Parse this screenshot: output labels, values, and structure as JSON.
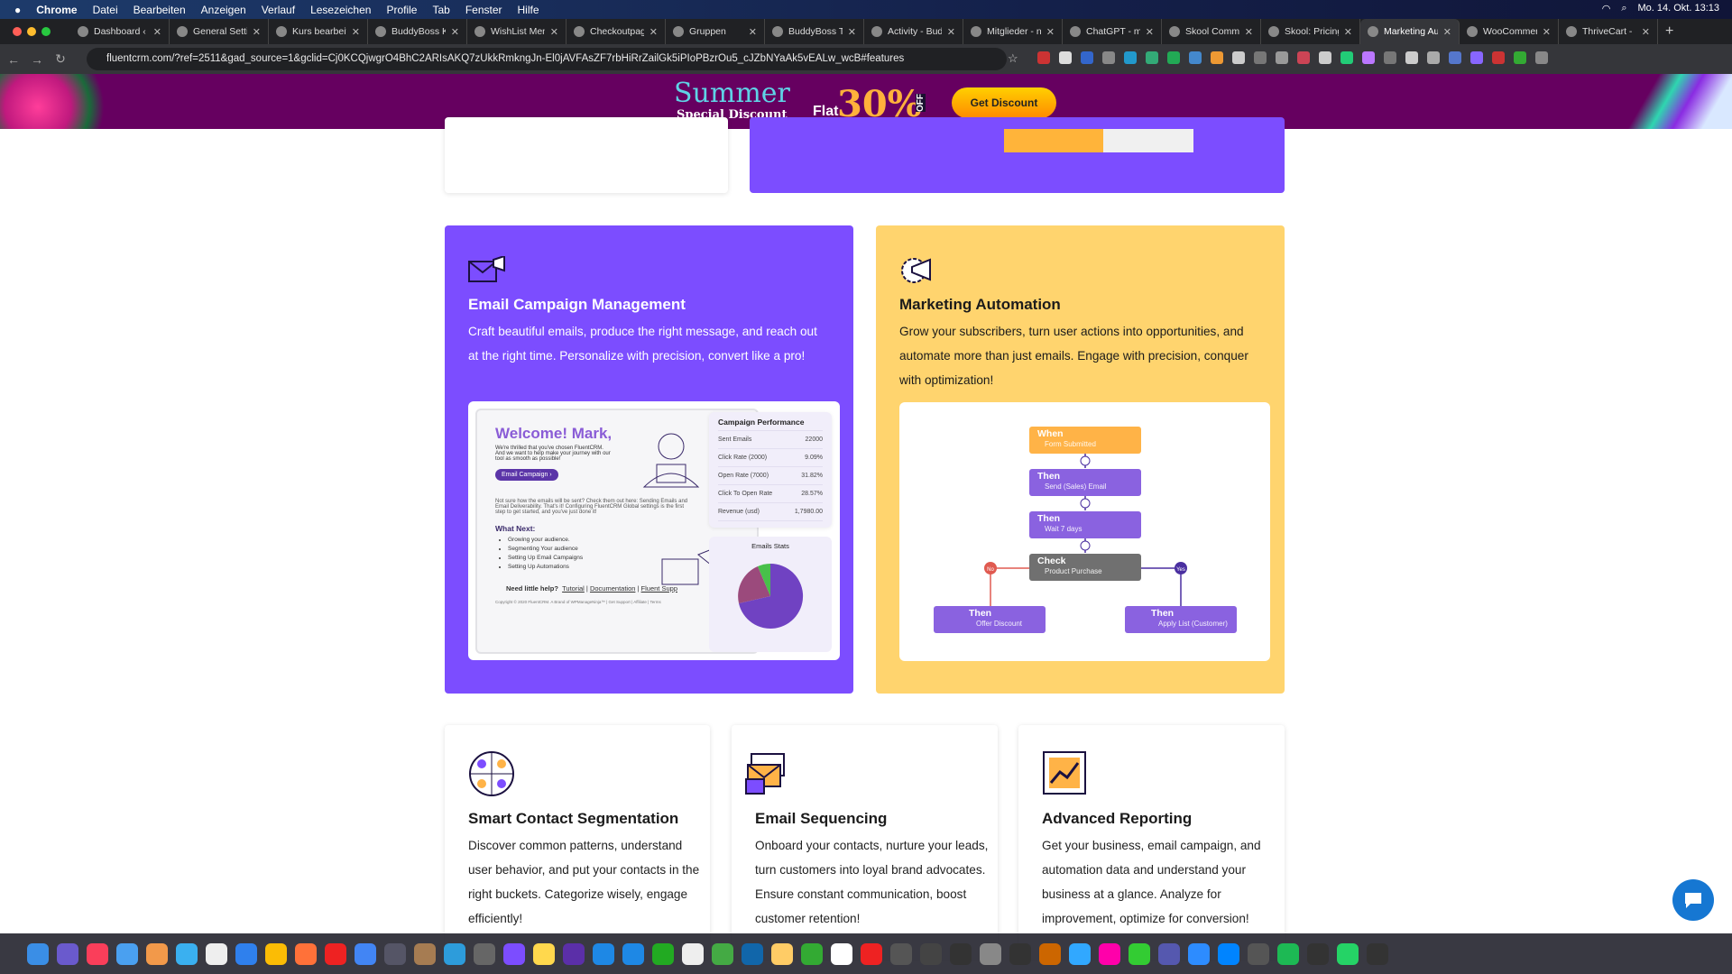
{
  "menubar": {
    "apple": "",
    "app": "Chrome",
    "items": [
      "Datei",
      "Bearbeiten",
      "Anzeigen",
      "Verlauf",
      "Lesezeichen",
      "Profile",
      "Tab",
      "Fenster",
      "Hilfe"
    ],
    "datetime": "Mo. 14. Okt. 13:13"
  },
  "tabs": [
    {
      "label": "Dashboard ‹",
      "active": false
    },
    {
      "label": "General Setti",
      "active": false
    },
    {
      "label": "Kurs bearbeit",
      "active": false
    },
    {
      "label": "BuddyBoss K",
      "active": false
    },
    {
      "label": "WishList Men",
      "active": false
    },
    {
      "label": "Checkoutpag",
      "active": false
    },
    {
      "label": "Gruppen",
      "active": false
    },
    {
      "label": "BuddyBoss T",
      "active": false
    },
    {
      "label": "Activity - Bud",
      "active": false
    },
    {
      "label": "Mitglieder - n",
      "active": false
    },
    {
      "label": "ChatGPT - m",
      "active": false
    },
    {
      "label": "Skool Comm",
      "active": false
    },
    {
      "label": "Skool: Pricing",
      "active": false
    },
    {
      "label": "Marketing Au",
      "active": true
    },
    {
      "label": "WooCommer",
      "active": false
    },
    {
      "label": "ThriveCart -",
      "active": false
    }
  ],
  "address": {
    "url": "fluentcrm.com/?ref=2511&gad_source=1&gclid=Cj0KCQjwgrO4BhC2ARIsAKQ7zUkkRmkngJn-El0jAVFAsZF7rbHiRrZailGk5iPIoPBzrOu5_cJZbNYaAk5vEALw_wcB#features"
  },
  "banner": {
    "summer": "Summer",
    "special": "Special Discount",
    "flat": "Flat",
    "percent": "30%",
    "off": "OFF",
    "button": "Get Discount"
  },
  "features": {
    "email": {
      "title": "Email Campaign Management",
      "desc": "Craft beautiful emails, produce the right message, and reach out at the right time. Personalize with precision, convert like a pro!",
      "color": "#7c4dff",
      "preview": {
        "welcome": "Welcome! Mark,",
        "intro": "We're thrilled that you've chosen FluentCRM. And we want to help make your journey with our tool as smooth as possible!",
        "button": "Email Campaign ›",
        "note": "Not sure how the emails will be sent? Check them out here: Sending Emails and Email Deliverability. That's it! Configuring FluentCRM Global settings is the first step to get started, and you've just done it!",
        "what_next": "What Next:",
        "next_items": [
          "Growing your audience.",
          "Segmenting Your audience",
          "Setting Up Email Campaigns",
          "Setting Up Automations"
        ],
        "help": "Need little help?",
        "links": [
          "Tutorial",
          "Documentation",
          "Fluent Supp"
        ],
        "copyright": "Copyright © 2020 FluentCRM. A Brand of WPManageNinja™ | Get Support | Affiliate | Terms"
      },
      "performance": {
        "title": "Campaign Performance",
        "rows": [
          {
            "label": "Sent Emails",
            "value": "22000"
          },
          {
            "label": "Click Rate (2000)",
            "value": "9.09%"
          },
          {
            "label": "Open Rate (7000)",
            "value": "31.82%"
          },
          {
            "label": "Click To Open Rate",
            "value": "28.57%"
          },
          {
            "label": "Revenue (usd)",
            "value": "1,7980.00"
          }
        ],
        "stats_title": "Emails Stats"
      }
    },
    "automation": {
      "title": "Marketing Automation",
      "desc": "Grow your subscribers, turn user actions into opportunities, and automate more than just emails. Engage with precision, conquer with optimization!",
      "color": "#ffd46e",
      "nodes": [
        {
          "head": "When",
          "sub": "Form Submitted"
        },
        {
          "head": "Then",
          "sub": "Send (Sales) Email"
        },
        {
          "head": "Then",
          "sub": "Wait 7 days"
        },
        {
          "head": "Check",
          "sub": "Product Purchase"
        },
        {
          "head": "Then",
          "sub": "Offer Discount"
        },
        {
          "head": "Then",
          "sub": "Apply List (Customer)"
        }
      ],
      "no": "No",
      "yes": "Yes"
    },
    "segmentation": {
      "title": "Smart Contact Segmentation",
      "desc": "Discover common patterns, understand user behavior, and put your contacts in the right buckets. Categorize wisely, engage efficiently!"
    },
    "sequencing": {
      "title": "Email Sequencing",
      "desc": "Onboard your contacts, nurture your leads, turn customers into loyal brand advocates. Ensure constant communication, boost customer retention!"
    },
    "reporting": {
      "title": "Advanced Reporting",
      "desc": "Get your business, email campaign, and automation data and understand your business at a glance. Analyze for improvement, optimize for conversion!"
    }
  }
}
